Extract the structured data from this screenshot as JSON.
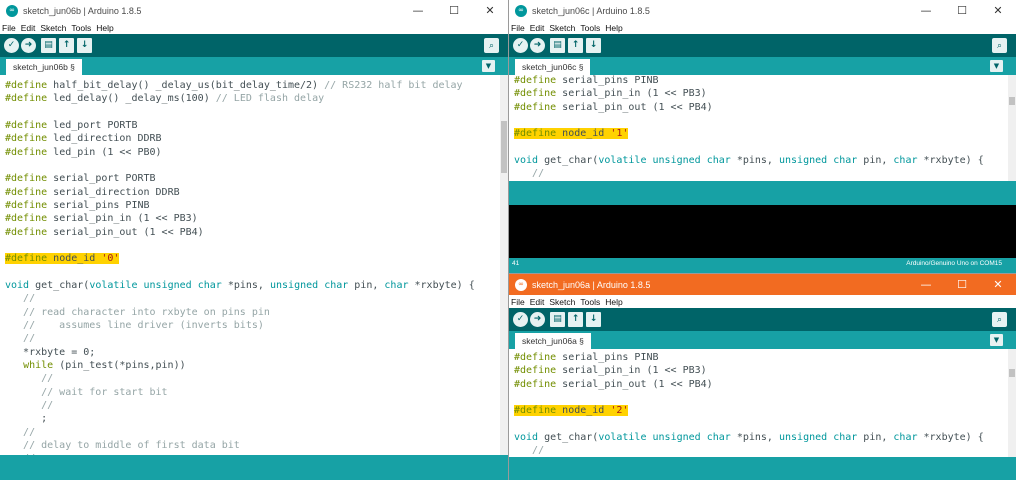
{
  "windows": {
    "left": {
      "title": "sketch_jun06b | Arduino 1.8.5",
      "tab": "sketch_jun06b §",
      "lines": [
        [
          {
            "t": "#define",
            "c": "kw"
          },
          {
            "t": " half_bit_delay() _delay_us(bit_delay_time/2) "
          },
          {
            "t": "// RS232 half bit delay",
            "c": "cm"
          }
        ],
        [
          {
            "t": "#define",
            "c": "kw"
          },
          {
            "t": " led_delay() _delay_ms(100) "
          },
          {
            "t": "// LED flash delay",
            "c": "cm"
          }
        ],
        [],
        [
          {
            "t": "#define",
            "c": "kw"
          },
          {
            "t": " led_port PORTB"
          }
        ],
        [
          {
            "t": "#define",
            "c": "kw"
          },
          {
            "t": " led_direction DDRB"
          }
        ],
        [
          {
            "t": "#define",
            "c": "kw"
          },
          {
            "t": " led_pin (1 << PB0)"
          }
        ],
        [],
        [
          {
            "t": "#define",
            "c": "kw"
          },
          {
            "t": " serial_port PORTB"
          }
        ],
        [
          {
            "t": "#define",
            "c": "kw"
          },
          {
            "t": " serial_direction DDRB"
          }
        ],
        [
          {
            "t": "#define",
            "c": "kw"
          },
          {
            "t": " serial_pins PINB"
          }
        ],
        [
          {
            "t": "#define",
            "c": "kw"
          },
          {
            "t": " serial_pin_in (1 << PB3)"
          }
        ],
        [
          {
            "t": "#define",
            "c": "kw"
          },
          {
            "t": " serial_pin_out (1 << PB4)"
          }
        ],
        [],
        [
          {
            "t": "#define",
            "c": "kw",
            "h": true
          },
          {
            "t": " node_id ",
            "h": true
          },
          {
            "t": "'0'",
            "c": "st",
            "h": true
          }
        ],
        [],
        [
          {
            "t": "void",
            "c": "ty"
          },
          {
            "t": " get_char("
          },
          {
            "t": "volatile",
            "c": "ty"
          },
          {
            "t": " "
          },
          {
            "t": "unsigned",
            "c": "ty"
          },
          {
            "t": " "
          },
          {
            "t": "char",
            "c": "ty"
          },
          {
            "t": " *pins, "
          },
          {
            "t": "unsigned",
            "c": "ty"
          },
          {
            "t": " "
          },
          {
            "t": "char",
            "c": "ty"
          },
          {
            "t": " pin, "
          },
          {
            "t": "char",
            "c": "ty"
          },
          {
            "t": " *rxbyte) {"
          }
        ],
        [
          {
            "t": "   //",
            "c": "cm"
          }
        ],
        [
          {
            "t": "   // read character into rxbyte on pins pin",
            "c": "cm"
          }
        ],
        [
          {
            "t": "   //    assumes line driver (inverts bits)",
            "c": "cm"
          }
        ],
        [
          {
            "t": "   //",
            "c": "cm"
          }
        ],
        [
          {
            "t": "   *rxbyte = 0;"
          }
        ],
        [
          {
            "t": "   "
          },
          {
            "t": "while",
            "c": "kw"
          },
          {
            "t": " (pin_test(*pins,pin))"
          }
        ],
        [
          {
            "t": "      //",
            "c": "cm"
          }
        ],
        [
          {
            "t": "      // wait for start bit",
            "c": "cm"
          }
        ],
        [
          {
            "t": "      //",
            "c": "cm"
          }
        ],
        [
          {
            "t": "      ;"
          }
        ],
        [
          {
            "t": "   //",
            "c": "cm"
          }
        ],
        [
          {
            "t": "   // delay to middle of first data bit",
            "c": "cm"
          }
        ],
        [
          {
            "t": "   //",
            "c": "cm"
          }
        ]
      ]
    },
    "top_right": {
      "title": "sketch_jun06c | Arduino 1.8.5",
      "tab": "sketch_jun06c §",
      "lines": [
        [
          {
            "t": "#define",
            "c": "kw"
          },
          {
            "t": " serial_pins PINB"
          }
        ],
        [
          {
            "t": "#define",
            "c": "kw"
          },
          {
            "t": " serial_pin_in (1 << PB3)"
          }
        ],
        [
          {
            "t": "#define",
            "c": "kw"
          },
          {
            "t": " serial_pin_out (1 << PB4)"
          }
        ],
        [],
        [
          {
            "t": "#define",
            "c": "kw",
            "h": true
          },
          {
            "t": " node_id ",
            "h": true
          },
          {
            "t": "'1'",
            "c": "st",
            "h": true
          }
        ],
        [],
        [
          {
            "t": "void",
            "c": "ty"
          },
          {
            "t": " get_char("
          },
          {
            "t": "volatile",
            "c": "ty"
          },
          {
            "t": " "
          },
          {
            "t": "unsigned",
            "c": "ty"
          },
          {
            "t": " "
          },
          {
            "t": "char",
            "c": "ty"
          },
          {
            "t": " *pins, "
          },
          {
            "t": "unsigned",
            "c": "ty"
          },
          {
            "t": " "
          },
          {
            "t": "char",
            "c": "ty"
          },
          {
            "t": " pin, "
          },
          {
            "t": "char",
            "c": "ty"
          },
          {
            "t": " *rxbyte) {"
          }
        ],
        [
          {
            "t": "   //",
            "c": "cm"
          }
        ]
      ],
      "status_line": "41",
      "status_board": "Arduino/Genuino Uno on COM15"
    },
    "bottom_right": {
      "title": "sketch_jun06a | Arduino 1.8.5",
      "tab": "sketch_jun06a §",
      "lines": [
        [
          {
            "t": "#define",
            "c": "kw"
          },
          {
            "t": " serial_pins PINB"
          }
        ],
        [
          {
            "t": "#define",
            "c": "kw"
          },
          {
            "t": " serial_pin_in (1 << PB3)"
          }
        ],
        [
          {
            "t": "#define",
            "c": "kw"
          },
          {
            "t": " serial_pin_out (1 << PB4)"
          }
        ],
        [],
        [
          {
            "t": "#define",
            "c": "kw",
            "h": true
          },
          {
            "t": " node_id ",
            "h": true
          },
          {
            "t": "'2'",
            "c": "st",
            "h": true
          }
        ],
        [],
        [
          {
            "t": "void",
            "c": "ty"
          },
          {
            "t": " get_char("
          },
          {
            "t": "volatile",
            "c": "ty"
          },
          {
            "t": " "
          },
          {
            "t": "unsigned",
            "c": "ty"
          },
          {
            "t": " "
          },
          {
            "t": "char",
            "c": "ty"
          },
          {
            "t": " *pins, "
          },
          {
            "t": "unsigned",
            "c": "ty"
          },
          {
            "t": " "
          },
          {
            "t": "char",
            "c": "ty"
          },
          {
            "t": " pin, "
          },
          {
            "t": "char",
            "c": "ty"
          },
          {
            "t": " *rxbyte) {"
          }
        ],
        [
          {
            "t": "   //",
            "c": "cm"
          }
        ]
      ]
    }
  },
  "menu": [
    "File",
    "Edit",
    "Sketch",
    "Tools",
    "Help"
  ],
  "icons": {
    "app": "∞",
    "minimize": "—",
    "maximize": "☐",
    "close": "✕",
    "verify": "✓",
    "upload": "➜",
    "new": "▤",
    "open": "↑",
    "save": "↓",
    "serial_monitor": "⌕",
    "tab_menu": "▼"
  },
  "colors": {
    "teal_dark": "#006468",
    "teal": "#17a1a5",
    "active_title": "#f26b21",
    "highlight": "#ffd200"
  }
}
